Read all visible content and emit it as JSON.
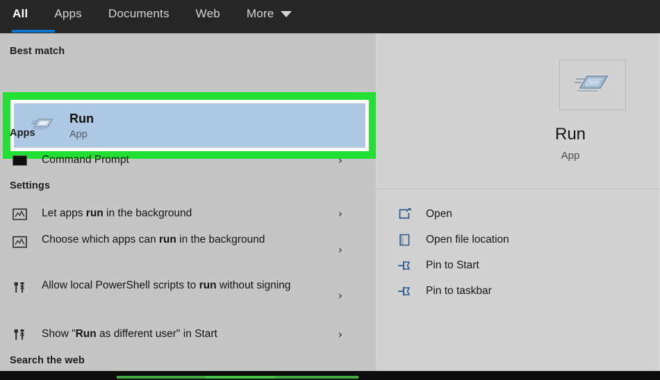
{
  "tabbar": {
    "tabs": [
      {
        "label": "All",
        "active": true
      },
      {
        "label": "Apps",
        "active": false
      },
      {
        "label": "Documents",
        "active": false
      },
      {
        "label": "Web",
        "active": false
      },
      {
        "label": "More",
        "active": false,
        "icon": "chevron-down-icon"
      }
    ],
    "accent_color": "#0a76d0",
    "background_color": "#262626"
  },
  "left_pane": {
    "headings": {
      "best_match": "Best match",
      "apps": "Apps",
      "settings": "Settings",
      "search_the_web": "Search the web"
    },
    "best_match": {
      "title": "Run",
      "subtitle": "App",
      "icon": "run-app-icon",
      "highlight_color": "#aec8e3",
      "annotation_color": "#22e033"
    },
    "apps": [
      {
        "label": "Command Prompt",
        "icon": "console-icon",
        "chevron": "›"
      }
    ],
    "settings": [
      {
        "label_parts": [
          {
            "text": "Let apps ",
            "bold": false
          },
          {
            "text": "run",
            "bold": true
          },
          {
            "text": " in the background",
            "bold": false
          }
        ],
        "icon": "monitor-chart-icon",
        "chevron": "›"
      },
      {
        "label_parts": [
          {
            "text": "Choose which apps can ",
            "bold": false
          },
          {
            "text": "run",
            "bold": true
          },
          {
            "text": " in the background",
            "bold": false
          }
        ],
        "icon": "monitor-chart-icon",
        "chevron": "›"
      },
      {
        "label_parts": [
          {
            "text": "Allow local PowerShell scripts to ",
            "bold": false
          },
          {
            "text": "run",
            "bold": true
          },
          {
            "text": " without signing",
            "bold": false
          }
        ],
        "icon": "tools-icon",
        "chevron": "›"
      },
      {
        "label_parts": [
          {
            "text": "Show \"",
            "bold": false
          },
          {
            "text": "Run",
            "bold": true
          },
          {
            "text": " as different user\" in Start",
            "bold": false
          }
        ],
        "icon": "tools-icon",
        "chevron": "›"
      }
    ]
  },
  "right_pane": {
    "app_icon": "run-app-icon",
    "app_title": "Run",
    "app_subtitle": "App",
    "actions": [
      {
        "label": "Open",
        "icon": "open-icon"
      },
      {
        "label": "Open file location",
        "icon": "folder-open-icon"
      },
      {
        "label": "Pin to Start",
        "icon": "pin-icon"
      },
      {
        "label": "Pin to taskbar",
        "icon": "pin-icon"
      }
    ],
    "icon_color": "#2a5a8e"
  }
}
